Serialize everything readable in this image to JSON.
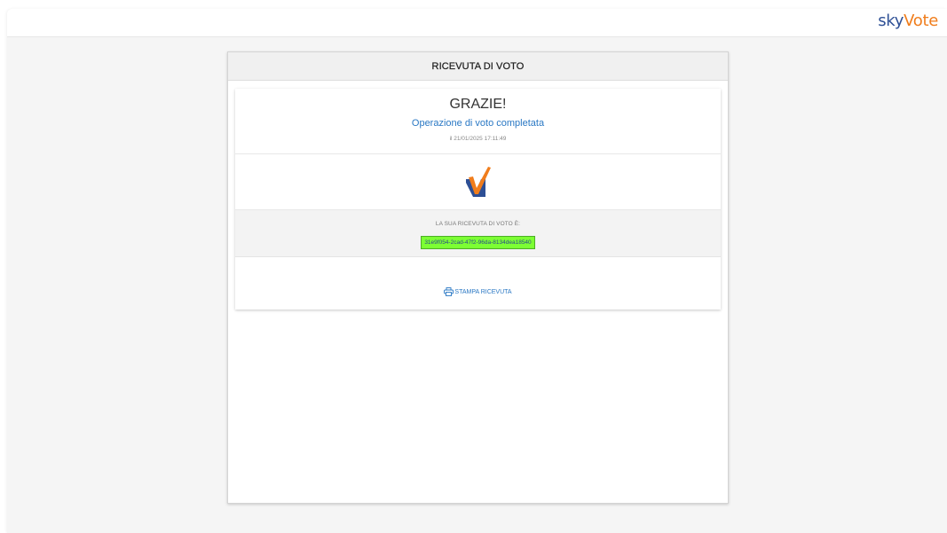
{
  "brand": {
    "part1": "sky",
    "part2": "Vote",
    "color1": "#2d4f95",
    "color2": "#f07d1c"
  },
  "panel": {
    "title": "RICEVUTA DI VOTO"
  },
  "confirmation": {
    "title": "GRAZIE!",
    "subtitle": "Operazione di voto completata",
    "date": "il 21/01/2025 17:11:49"
  },
  "check_logo": {
    "icon": "skyvote-check-icon"
  },
  "receipt": {
    "label": "LA SUA RICEVUTA DI VOTO È:",
    "code": "31e9f054-2cad-47f2-96da-8134dea18540"
  },
  "print": {
    "icon": "printer-icon",
    "label": "STAMPA RICEVUTA"
  }
}
